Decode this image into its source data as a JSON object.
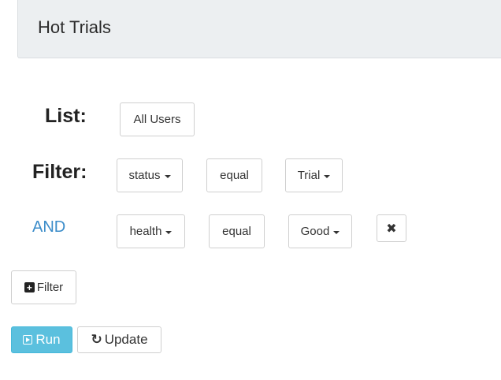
{
  "header": {
    "title": "Hot Trials"
  },
  "list_row": {
    "label": "List:",
    "value": "All Users"
  },
  "filters": [
    {
      "label": "Filter:",
      "field": "status",
      "operator": "equal",
      "value": "Trial"
    },
    {
      "label": "AND",
      "field": "health",
      "operator": "equal",
      "value": "Good",
      "remove_icon": "close-icon"
    }
  ],
  "actions": {
    "add_filter_label": "Filter",
    "run_label": "Run",
    "update_label": "Update"
  },
  "colors": {
    "run_button": "#5bc0de",
    "and_label": "#3c8dca",
    "header_bg": "#eceff1"
  },
  "icons": {
    "add_filter": "plus-square-icon",
    "run": "play-square-icon",
    "update": "refresh-icon"
  }
}
